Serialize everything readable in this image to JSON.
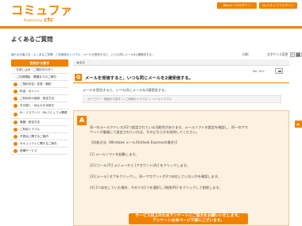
{
  "header": {
    "logo_main": "コミュファ",
    "logo_sub": "Powered by",
    "logo_brand": "ctc",
    "buttons": [
      "Webメールログイン",
      "Myコミュファログイン"
    ]
  },
  "page_title": "よくあるご質問",
  "breadcrumb": {
    "items": [
      "個人のお客さま",
      "よくあるご質問",
      "ご利用時のトラブル"
    ],
    "current": "メールを受信すると、いつも同じメールを2通受信する。"
  },
  "utility": {
    "print_label": "印刷",
    "font_label": "文字サイズ変更",
    "font_sizes": [
      "大",
      "中",
      "小"
    ]
  },
  "sidebar": {
    "heading": "目的から探す",
    "items": [
      {
        "label": "お申し込み・ご検討中の方へ",
        "icon": "arrow",
        "tall": false
      },
      {
        "label": "ご利用開始・開通までのご案内",
        "icon": "arrow",
        "tall": false
      },
      {
        "label": "ご契約内容・変更・解約",
        "icon": "circle",
        "tall": false
      },
      {
        "label": "料金・ポイント",
        "icon": "circle",
        "tall": false
      },
      {
        "label": "ご利用中の接続・設定方法",
        "icon": "circle",
        "tall": false
      },
      {
        "label": "お引越し・休止のお手続き",
        "icon": "circle",
        "tall": false
      },
      {
        "label": "ID・パスワード・Myコミュファ関連",
        "icon": "circle",
        "tall": true
      },
      {
        "label": "機器・設定方法",
        "icon": "circle",
        "tall": false
      },
      {
        "label": "ご利用トラブル",
        "icon": "circle",
        "tall": false
      },
      {
        "label": "不具合に関するご案内",
        "icon": "circle",
        "tall": false
      },
      {
        "label": "セキュリティに関するご案内",
        "icon": "circle",
        "tall": false
      },
      {
        "label": "各種サービス",
        "icon": "circle",
        "tall": false
      }
    ]
  },
  "main": {
    "back_label": "戻る",
    "qa_no": "No：811",
    "q_badge": "Q",
    "question": "メールを受信すると、いつも同じメールを2通受信する。",
    "question_body": "メールを受信すると、いつも同じメールを2通受信する。",
    "category": "カテゴリー：接続から探す ＞ ご利用のトラブル ＞ メールトラブル",
    "a_badge": "A",
    "answer_lines": [
      "同一のメールアドレスが2つ設定されている可能性があります。メールソフトの設定を確認し、同一のアカ",
      "ウントが重複して設定されていれば、そのどちらかを削除してください。",
      "【対処方法（Windows メール/Outlook Expressの場合）】",
      "[1] メールソフトを起動します。",
      "[2] [ツール(T)] メニューから [アカウント(A)] をクリックします。",
      "[3] [メール] タブをクリックし、同一アカウントが2つ存在していないかを確認します。",
      "[4] 2つ存在していた場合、そのうち1つを選択し [削除(R)] をクリックして削除します。"
    ],
    "cta_lines": [
      "サービス向上のためアンケートにご協力をお願いいたします。",
      "アンケートは本ページ下部にございます。"
    ]
  },
  "colors": {
    "brand": "#f08200",
    "answer_bg": "#fdf1e1"
  }
}
